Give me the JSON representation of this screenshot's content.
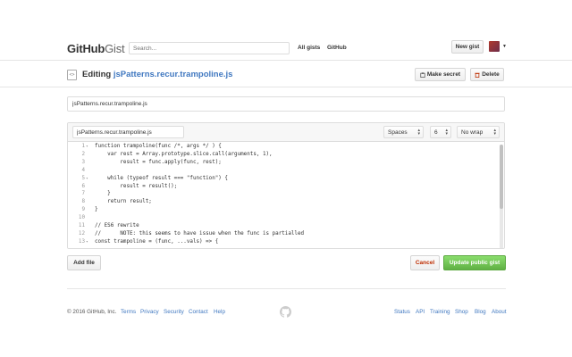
{
  "header": {
    "logo_main": "GitHub",
    "logo_sub": "Gist",
    "search_placeholder": "Search...",
    "nav": [
      "All gists",
      "GitHub"
    ],
    "new_gist_label": "New gist"
  },
  "titlebar": {
    "prefix": "Editing",
    "filename": "jsPatterns.recur.trampoline.js",
    "make_secret_label": "Make secret",
    "delete_label": "Delete",
    "file_icon": "<>"
  },
  "description": {
    "value": "jsPatterns.recur.trampoline.js"
  },
  "editor": {
    "filename_value": "jsPatterns.recur.trampoline.js",
    "indent_mode": "Spaces",
    "indent_size": "6",
    "wrap_mode": "No wrap",
    "lines": [
      {
        "n": "1",
        "fold": true,
        "text": "function trampoline(func /*, args */ ) {"
      },
      {
        "n": "2",
        "fold": false,
        "text": "    var rest = Array.prototype.slice.call(arguments, 1),"
      },
      {
        "n": "3",
        "fold": false,
        "text": "        result = func.apply(func, rest);"
      },
      {
        "n": "4",
        "fold": false,
        "text": ""
      },
      {
        "n": "5",
        "fold": true,
        "text": "    while (typeof result === \"function\") {"
      },
      {
        "n": "6",
        "fold": false,
        "text": "        result = result();"
      },
      {
        "n": "7",
        "fold": false,
        "text": "    }"
      },
      {
        "n": "8",
        "fold": false,
        "text": "    return result;"
      },
      {
        "n": "9",
        "fold": false,
        "text": "}"
      },
      {
        "n": "10",
        "fold": false,
        "text": ""
      },
      {
        "n": "11",
        "fold": false,
        "text": "// ES6 rewrite"
      },
      {
        "n": "12",
        "fold": false,
        "text": "//      NOTE: this seems to have issue when the func is partialled"
      },
      {
        "n": "13",
        "fold": true,
        "text": "const trampoline = (func, ...vals) => {"
      }
    ]
  },
  "actions": {
    "add_file_label": "Add file",
    "cancel_label": "Cancel",
    "update_label": "Update public gist"
  },
  "footer": {
    "copyright": "© 2016 GitHub, Inc.",
    "left_links": [
      "Terms",
      "Privacy",
      "Security",
      "Contact",
      "Help"
    ],
    "right_links": [
      "Status",
      "API",
      "Training",
      "Shop",
      "Blog",
      "About"
    ]
  },
  "colors": {
    "link": "#4078c0",
    "primary_green": "#60b044",
    "danger": "#bd2c00"
  },
  "icons": [
    "code-file-icon",
    "clipboard-icon",
    "trash-icon",
    "octocat-icon",
    "caret-down-icon"
  ]
}
